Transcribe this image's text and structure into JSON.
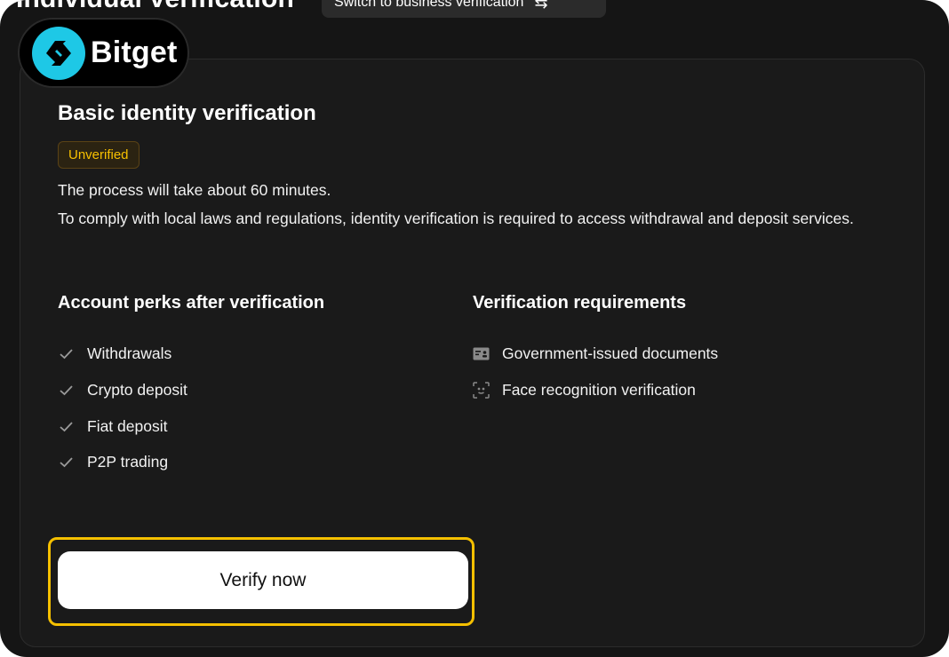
{
  "header": {
    "title": "Individual verification",
    "switch_label": "Switch to business verification"
  },
  "brand": {
    "name": "Bitget",
    "accent_color": "#1ec8e6"
  },
  "card": {
    "title": "Basic identity verification",
    "status_badge": "Unverified",
    "status_color": "#f7c000",
    "description_1": "The process will take about 60 minutes.",
    "description_2": "To comply with local laws and regulations, identity verification is required to access withdrawal and deposit services."
  },
  "perks": {
    "title": "Account perks after verification",
    "items": [
      {
        "label": "Withdrawals",
        "icon": "check-icon"
      },
      {
        "label": "Crypto deposit",
        "icon": "check-icon"
      },
      {
        "label": "Fiat deposit",
        "icon": "check-icon"
      },
      {
        "label": "P2P trading",
        "icon": "check-icon"
      }
    ]
  },
  "requirements": {
    "title": "Verification requirements",
    "items": [
      {
        "label": "Government-issued documents",
        "icon": "id-card-icon"
      },
      {
        "label": "Face recognition verification",
        "icon": "face-scan-icon"
      }
    ]
  },
  "actions": {
    "verify_label": "Verify now",
    "highlight_color": "#f5c000"
  }
}
